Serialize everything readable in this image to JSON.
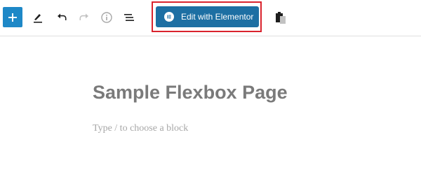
{
  "toolbar": {
    "icons": {
      "add": "plus-icon",
      "tools": "pencil-icon",
      "undo": "undo-icon",
      "redo": "redo-icon",
      "details": "info-icon",
      "outline": "list-view-icon",
      "clipboard": "clipboard-icon"
    },
    "elementor_button": {
      "label": "Edit with Elementor",
      "icon": "elementor-logo-icon",
      "color": "#1d6fa3",
      "highlight_color": "#d9232d"
    },
    "add_button_color": "#1e88c7"
  },
  "editor": {
    "title": "Sample Flexbox Page",
    "block_placeholder": "Type / to choose a block"
  }
}
